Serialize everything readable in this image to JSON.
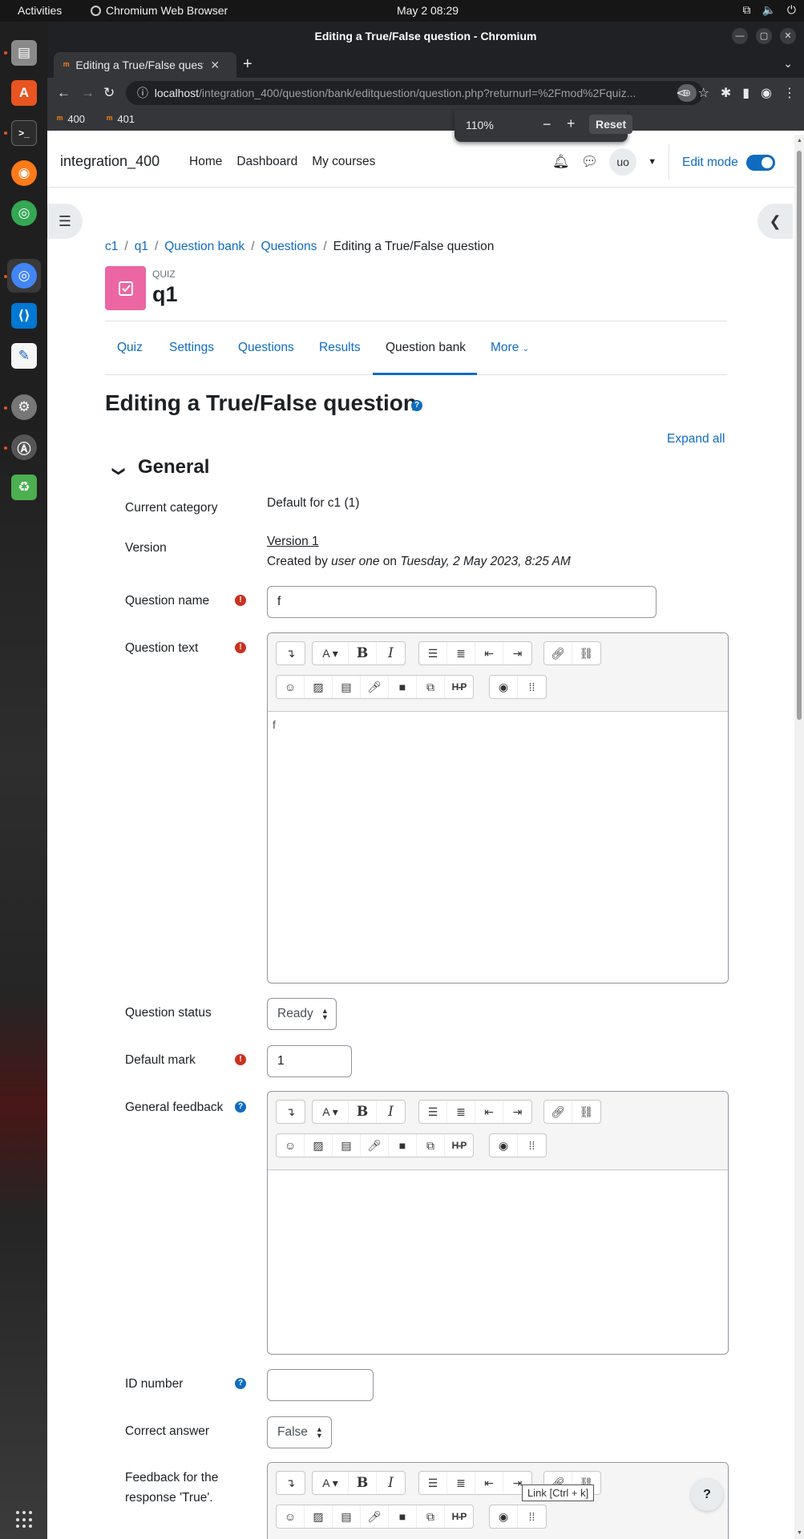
{
  "topbar": {
    "activities": "Activities",
    "app_name": "Chromium Web Browser",
    "clock": "May 2  08:29"
  },
  "browser": {
    "window_title": "Editing a True/False question - Chromium",
    "tab_title": "Editing a True/False quest",
    "url_host": "localhost",
    "url_path": "/integration_400/question/bank/editquestion/question.php?returnurl=%2Fmod%2Fquiz...",
    "bookmarks": [
      {
        "label": "400"
      },
      {
        "label": "401"
      }
    ],
    "zoom": {
      "percent": "110%",
      "minus": "−",
      "plus": "+",
      "reset": "Reset"
    }
  },
  "navbar": {
    "brand": "integration_400",
    "links": [
      "Home",
      "Dashboard",
      "My courses"
    ],
    "avatar_initials": "uo",
    "edit_mode": "Edit mode"
  },
  "breadcrumb": {
    "items": [
      "c1",
      "q1",
      "Question bank",
      "Questions"
    ],
    "current": "Editing a True/False question"
  },
  "module": {
    "type": "QUIZ",
    "name": "q1"
  },
  "secondary_nav": {
    "items": [
      "Quiz",
      "Settings",
      "Questions",
      "Results",
      "Question bank",
      "More"
    ],
    "active": "Question bank"
  },
  "form": {
    "heading": "Editing a True/False question",
    "expand_all": "Expand all",
    "section_title": "General",
    "current_category": {
      "label": "Current category",
      "value": "Default for c1 (1)"
    },
    "version": {
      "label": "Version",
      "link": "Version 1",
      "created_prefix": "Created by ",
      "created_user": "user one",
      "created_mid": " on ",
      "created_date": "Tuesday, 2 May 2023, 8:25 AM"
    },
    "question_name": {
      "label": "Question name",
      "value": "f"
    },
    "question_text": {
      "label": "Question text",
      "value": "f"
    },
    "question_status": {
      "label": "Question status",
      "value": "Ready"
    },
    "default_mark": {
      "label": "Default mark",
      "value": "1"
    },
    "general_feedback": {
      "label": "General feedback",
      "value": ""
    },
    "id_number": {
      "label": "ID number",
      "value": ""
    },
    "correct_answer": {
      "label": "Correct answer",
      "value": "False"
    },
    "feedback_true": {
      "label_line1": "Feedback for the",
      "label_line2": "response 'True'."
    }
  },
  "tooltip": "Link [Ctrl + k]",
  "help_button": "?"
}
